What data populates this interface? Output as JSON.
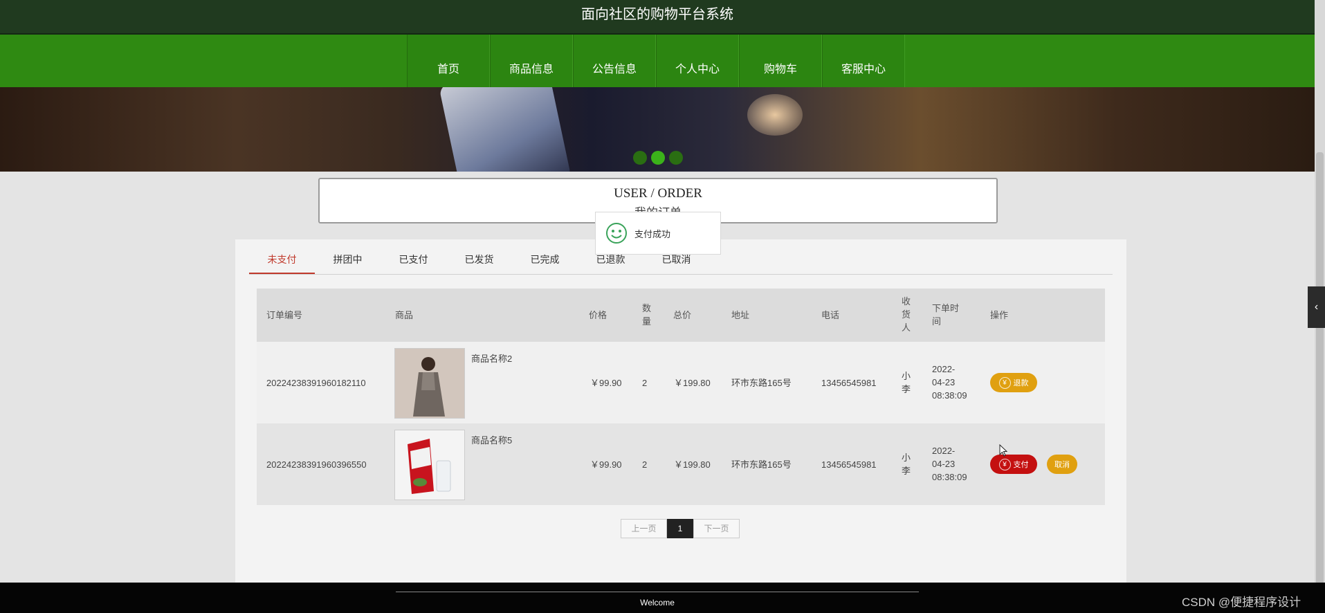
{
  "app_title": "面向社区的购物平台系统",
  "nav": [
    "首页",
    "商品信息",
    "公告信息",
    "个人中心",
    "购物车",
    "客服中心"
  ],
  "order_heading": {
    "en": "USER / ORDER",
    "cn": "我的订单"
  },
  "toast": {
    "message": "支付成功"
  },
  "tabs": [
    "未支付",
    "拼团中",
    "已支付",
    "已发货",
    "已完成",
    "已退款",
    "已取消"
  ],
  "active_tab": "未支付",
  "table": {
    "headers": {
      "order_no": "订单编号",
      "product": "商品",
      "price": "价格",
      "qty": "数\n量",
      "total": "总价",
      "address": "地址",
      "phone": "电话",
      "receiver": "收\n货\n人",
      "time": "下单时\n间",
      "action": "操作"
    },
    "rows": [
      {
        "order_no": "20224238391960182110",
        "product_name": "商品名称2",
        "price": "￥99.90",
        "qty": "2",
        "total": "￥199.80",
        "address": "环市东路165号",
        "phone": "13456545981",
        "receiver": "小\n李",
        "time": "2022-\n04-23\n08:38:09",
        "actions": [
          "退款"
        ]
      },
      {
        "order_no": "20224238391960396550",
        "product_name": "商品名称5",
        "price": "￥99.90",
        "qty": "2",
        "total": "￥199.80",
        "address": "环市东路165号",
        "phone": "13456545981",
        "receiver": "小\n李",
        "time": "2022-\n04-23\n08:38:09",
        "actions": [
          "支付",
          "取消"
        ]
      }
    ]
  },
  "pager": {
    "prev": "上一页",
    "current": "1",
    "next": "下一页"
  },
  "footer": {
    "text": "Welcome"
  },
  "watermark": "CSDN @便捷程序设计",
  "colors": {
    "topbar": "#203a1f",
    "nav": "#2f8a12",
    "pay": "#c41010",
    "refund": "#e0a010",
    "active_tab": "#c0392b"
  },
  "icons": {
    "toast": "smile-icon",
    "pay": "yen-icon",
    "side": "chevron-left-icon"
  }
}
